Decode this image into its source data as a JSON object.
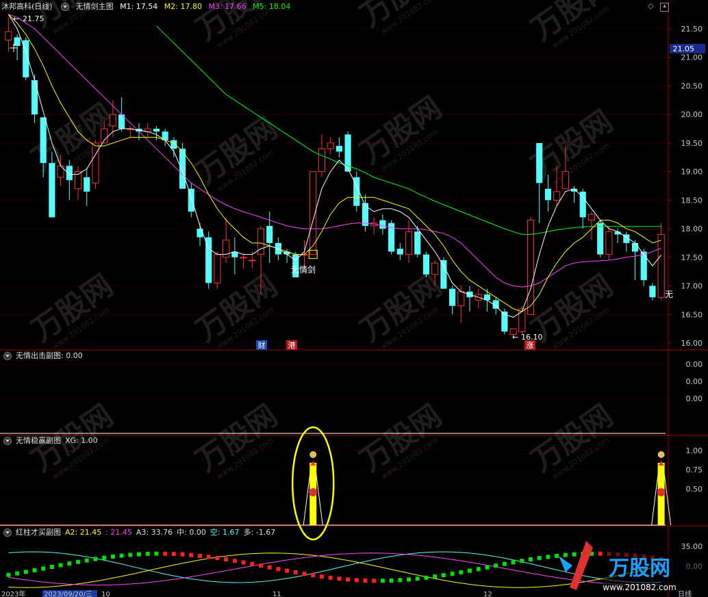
{
  "main_title": {
    "stock": "沐邦高科(日线)",
    "indicator": "无情剑主图",
    "m1_label": "M1: 17.54",
    "m2_label": "M2: 17.80",
    "m3_label": "M3: 17.66",
    "m5_label": "M5: 18.04"
  },
  "colors": {
    "m1": "#ffffff",
    "m2": "#ffff00",
    "m3": "#ff44ff",
    "m5": "#00ff00",
    "up": "#ff3232",
    "down": "#54fcfc",
    "axis": "#b00000"
  },
  "main_price_axis": [
    "21.50",
    "21.00",
    "20.50",
    "20.00",
    "19.50",
    "19.00",
    "18.50",
    "18.00",
    "17.50",
    "17.00",
    "16.50",
    "16.00"
  ],
  "current_price_tag": "21.05",
  "annotations": {
    "high": "21.75",
    "low": "16.10",
    "signal": "无情剑",
    "signal_right": "无"
  },
  "badges": {
    "cai": "财",
    "gang": "港",
    "zhang": "涨"
  },
  "sub1": {
    "title": "无情出击副图",
    "value": ": 0.00",
    "axis": [
      "0.00",
      "0.00",
      "0.00"
    ]
  },
  "sub2": {
    "title": "无情稳赢副图",
    "value": "XG: 1.00",
    "axis": [
      "1.00",
      "0.75",
      "0.50"
    ]
  },
  "sub3": {
    "title": "红柱才买副图",
    "a2": "A2: 21.45",
    "v2": ": 21.45",
    "a3": "A3: 33.76",
    "zhong": "中: 0.00",
    "kong": "空: 1.67",
    "duo": "多: -1.67",
    "axis": [
      "35.00",
      "0.00"
    ]
  },
  "time_axis": [
    "2023年",
    "2023/09/20/三",
    "10",
    "11",
    "12"
  ],
  "bottom_right": "日线",
  "watermark": "万股网",
  "watermark_url": "www.201082.com",
  "logo_text": "万股网",
  "logo_url": "www.201082.com",
  "candles": [
    [
      21.3,
      21.45,
      21.7,
      21.1
    ],
    [
      21.35,
      21.2,
      21.4,
      20.95
    ],
    [
      21.3,
      20.65,
      21.35,
      20.6
    ],
    [
      20.6,
      20.0,
      20.7,
      19.85
    ],
    [
      19.95,
      19.15,
      19.95,
      18.9
    ],
    [
      19.15,
      18.2,
      19.35,
      18.2
    ],
    [
      18.9,
      19.1,
      19.3,
      18.75
    ],
    [
      19.1,
      18.85,
      19.2,
      18.5
    ],
    [
      18.7,
      19.0,
      19.1,
      18.5
    ],
    [
      18.9,
      18.65,
      19.05,
      18.4
    ],
    [
      18.8,
      19.5,
      19.55,
      18.7
    ],
    [
      19.5,
      19.75,
      19.9,
      19.5
    ],
    [
      19.8,
      20.0,
      20.25,
      19.6
    ],
    [
      20.0,
      19.75,
      20.3,
      19.7
    ],
    [
      19.75,
      19.75,
      19.8,
      19.6
    ],
    [
      19.75,
      19.7,
      19.85,
      19.55
    ],
    [
      19.7,
      19.75,
      19.85,
      19.6
    ],
    [
      19.75,
      19.7,
      19.8,
      19.55
    ],
    [
      19.7,
      19.55,
      19.75,
      19.45
    ],
    [
      19.55,
      19.4,
      19.6,
      19.25
    ],
    [
      19.4,
      18.7,
      19.5,
      18.7
    ],
    [
      18.7,
      18.3,
      18.8,
      18.2
    ],
    [
      18.0,
      17.85,
      18.1,
      17.7
    ],
    [
      17.85,
      17.05,
      17.95,
      16.95
    ],
    [
      17.05,
      17.55,
      17.6,
      16.95
    ],
    [
      17.5,
      17.8,
      18.2,
      17.4
    ],
    [
      17.6,
      17.5,
      17.85,
      17.2
    ],
    [
      17.5,
      17.5,
      17.55,
      17.3
    ],
    [
      17.45,
      17.45,
      17.6,
      17.3
    ],
    [
      17.55,
      18.0,
      18.05,
      16.85
    ],
    [
      18.05,
      17.75,
      18.3,
      17.4
    ],
    [
      17.75,
      17.55,
      17.85,
      17.45
    ],
    [
      17.6,
      17.55,
      17.65,
      17.4
    ],
    [
      17.55,
      17.15,
      17.6,
      17.15
    ],
    [
      17.55,
      17.55,
      17.8,
      17.3
    ],
    [
      17.55,
      19.0,
      19.0,
      17.55
    ],
    [
      19.0,
      19.4,
      19.65,
      18.9
    ],
    [
      19.4,
      19.5,
      19.6,
      19.3
    ],
    [
      19.45,
      19.35,
      19.6,
      19.25
    ],
    [
      19.65,
      19.0,
      19.7,
      19.0
    ],
    [
      18.9,
      18.4,
      19.0,
      18.3
    ],
    [
      18.45,
      18.05,
      18.6,
      17.95
    ],
    [
      18.05,
      18.1,
      18.2,
      17.9
    ],
    [
      18.15,
      18.0,
      18.25,
      17.9
    ],
    [
      18.1,
      17.6,
      18.15,
      17.55
    ],
    [
      17.65,
      17.55,
      17.75,
      17.45
    ],
    [
      17.55,
      17.95,
      18.15,
      17.4
    ],
    [
      17.95,
      17.55,
      18.05,
      17.5
    ],
    [
      17.55,
      17.2,
      17.6,
      17.15
    ],
    [
      17.2,
      17.4,
      17.45,
      17.0
    ],
    [
      17.45,
      16.95,
      17.5,
      16.95
    ],
    [
      16.95,
      16.65,
      17.0,
      16.5
    ],
    [
      16.65,
      16.9,
      17.0,
      16.35
    ],
    [
      16.9,
      16.8,
      17.0,
      16.55
    ],
    [
      16.75,
      16.85,
      16.95,
      16.6
    ],
    [
      16.85,
      16.75,
      16.95,
      16.55
    ],
    [
      16.75,
      16.6,
      16.8,
      16.5
    ],
    [
      16.55,
      16.2,
      16.6,
      16.15
    ],
    [
      16.15,
      16.25,
      16.25,
      16.1
    ],
    [
      16.2,
      16.6,
      16.65,
      16.15
    ],
    [
      16.5,
      18.15,
      18.2,
      16.5
    ],
    [
      19.5,
      18.8,
      19.5,
      18.1
    ],
    [
      18.7,
      18.5,
      18.95,
      18.3
    ],
    [
      18.5,
      18.65,
      19.1,
      18.4
    ],
    [
      18.7,
      19.0,
      19.45,
      18.7
    ],
    [
      18.7,
      18.65,
      18.75,
      18.45
    ],
    [
      18.65,
      18.2,
      18.7,
      18.0
    ],
    [
      18.15,
      18.25,
      18.3,
      17.8
    ],
    [
      18.1,
      17.55,
      18.15,
      17.5
    ],
    [
      17.55,
      17.95,
      18.05,
      17.45
    ],
    [
      17.95,
      17.9,
      18.0,
      17.75
    ],
    [
      17.9,
      17.75,
      17.95,
      17.6
    ],
    [
      17.75,
      17.6,
      17.8,
      17.1
    ],
    [
      17.6,
      17.1,
      17.65,
      17.0
    ],
    [
      17.0,
      16.8,
      17.05,
      16.75
    ],
    [
      16.8,
      17.9,
      18.1,
      16.75
    ]
  ],
  "ma": {
    "m1": [
      21.75,
      21.5,
      21.1,
      20.6,
      20.05,
      19.5,
      19.1,
      18.95,
      18.95,
      19.05,
      19.3,
      19.55,
      19.7,
      19.75,
      19.75,
      19.72,
      19.7,
      19.65,
      19.55,
      19.35,
      19.0,
      18.55,
      18.05,
      17.65,
      17.55,
      17.55,
      17.6,
      17.55,
      17.55,
      17.65,
      17.7,
      17.65,
      17.55,
      17.45,
      17.6,
      18.15,
      18.7,
      19.0,
      19.2,
      19.05,
      18.75,
      18.4,
      18.3,
      18.35,
      18.35,
      18.3,
      18.2,
      18.0,
      17.8,
      17.6,
      17.35,
      17.05,
      16.9,
      16.85,
      16.8,
      16.75,
      16.65,
      16.5,
      16.45,
      16.55,
      16.95,
      17.55,
      18.05,
      18.4,
      18.65,
      18.7,
      18.55,
      18.35,
      18.15,
      18.0,
      17.95,
      17.85,
      17.75,
      17.55,
      17.35,
      17.54
    ],
    "m2": [
      21.75,
      21.6,
      21.4,
      21.15,
      20.85,
      20.5,
      20.2,
      19.95,
      19.7,
      19.55,
      19.45,
      19.45,
      19.5,
      19.55,
      19.6,
      19.6,
      19.6,
      19.6,
      19.55,
      19.5,
      19.35,
      19.15,
      18.9,
      18.6,
      18.35,
      18.15,
      18.0,
      17.85,
      17.75,
      17.75,
      17.7,
      17.65,
      17.6,
      17.55,
      17.55,
      17.7,
      17.95,
      18.25,
      18.45,
      18.55,
      18.55,
      18.55,
      18.55,
      18.5,
      18.45,
      18.4,
      18.35,
      18.2,
      18.05,
      17.9,
      17.7,
      17.45,
      17.25,
      17.1,
      17.0,
      16.9,
      16.8,
      16.7,
      16.6,
      16.55,
      16.65,
      16.85,
      17.15,
      17.4,
      17.6,
      17.75,
      17.85,
      18.0,
      18.15,
      18.15,
      18.1,
      18.0,
      17.95,
      17.85,
      17.75,
      17.8
    ],
    "m3": [
      21.75,
      21.7,
      21.6,
      21.5,
      21.35,
      21.2,
      21.05,
      20.9,
      20.75,
      20.6,
      20.45,
      20.3,
      20.15,
      20.0,
      19.85,
      19.7,
      19.55,
      19.4,
      19.25,
      19.1,
      18.95,
      18.8,
      18.7,
      18.6,
      18.5,
      18.42,
      18.35,
      18.3,
      18.25,
      18.2,
      18.15,
      18.1,
      18.05,
      18.02,
      18.0,
      18.0,
      18.0,
      18.02,
      18.05,
      18.08,
      18.1,
      18.1,
      18.08,
      18.05,
      18.02,
      18.0,
      18.0,
      18.0,
      17.98,
      17.95,
      17.92,
      17.85,
      17.75,
      17.6,
      17.45,
      17.3,
      17.15,
      17.05,
      17.0,
      16.98,
      17.0,
      17.05,
      17.15,
      17.25,
      17.35,
      17.4,
      17.42,
      17.43,
      17.44,
      17.45,
      17.47,
      17.5,
      17.52,
      17.55,
      17.6,
      17.66
    ],
    "m5": [
      null,
      null,
      null,
      null,
      null,
      null,
      null,
      null,
      null,
      null,
      null,
      null,
      null,
      null,
      null,
      null,
      null,
      21.55,
      21.4,
      21.25,
      21.1,
      20.95,
      20.8,
      20.65,
      20.5,
      20.35,
      20.25,
      20.15,
      20.05,
      19.95,
      19.85,
      19.75,
      19.65,
      19.55,
      19.45,
      19.35,
      19.28,
      19.22,
      19.15,
      19.1,
      19.05,
      18.98,
      18.9,
      18.85,
      18.8,
      18.75,
      18.7,
      18.62,
      18.55,
      18.48,
      18.42,
      18.36,
      18.3,
      18.24,
      18.18,
      18.12,
      18.06,
      18.0,
      17.95,
      17.9,
      17.9,
      17.92,
      17.95,
      17.98,
      18.0,
      18.02,
      18.03,
      18.04,
      18.04,
      18.04,
      18.04,
      18.04,
      18.04,
      18.04,
      18.04,
      18.04
    ]
  },
  "sub2_signals": [
    35,
    75
  ]
}
